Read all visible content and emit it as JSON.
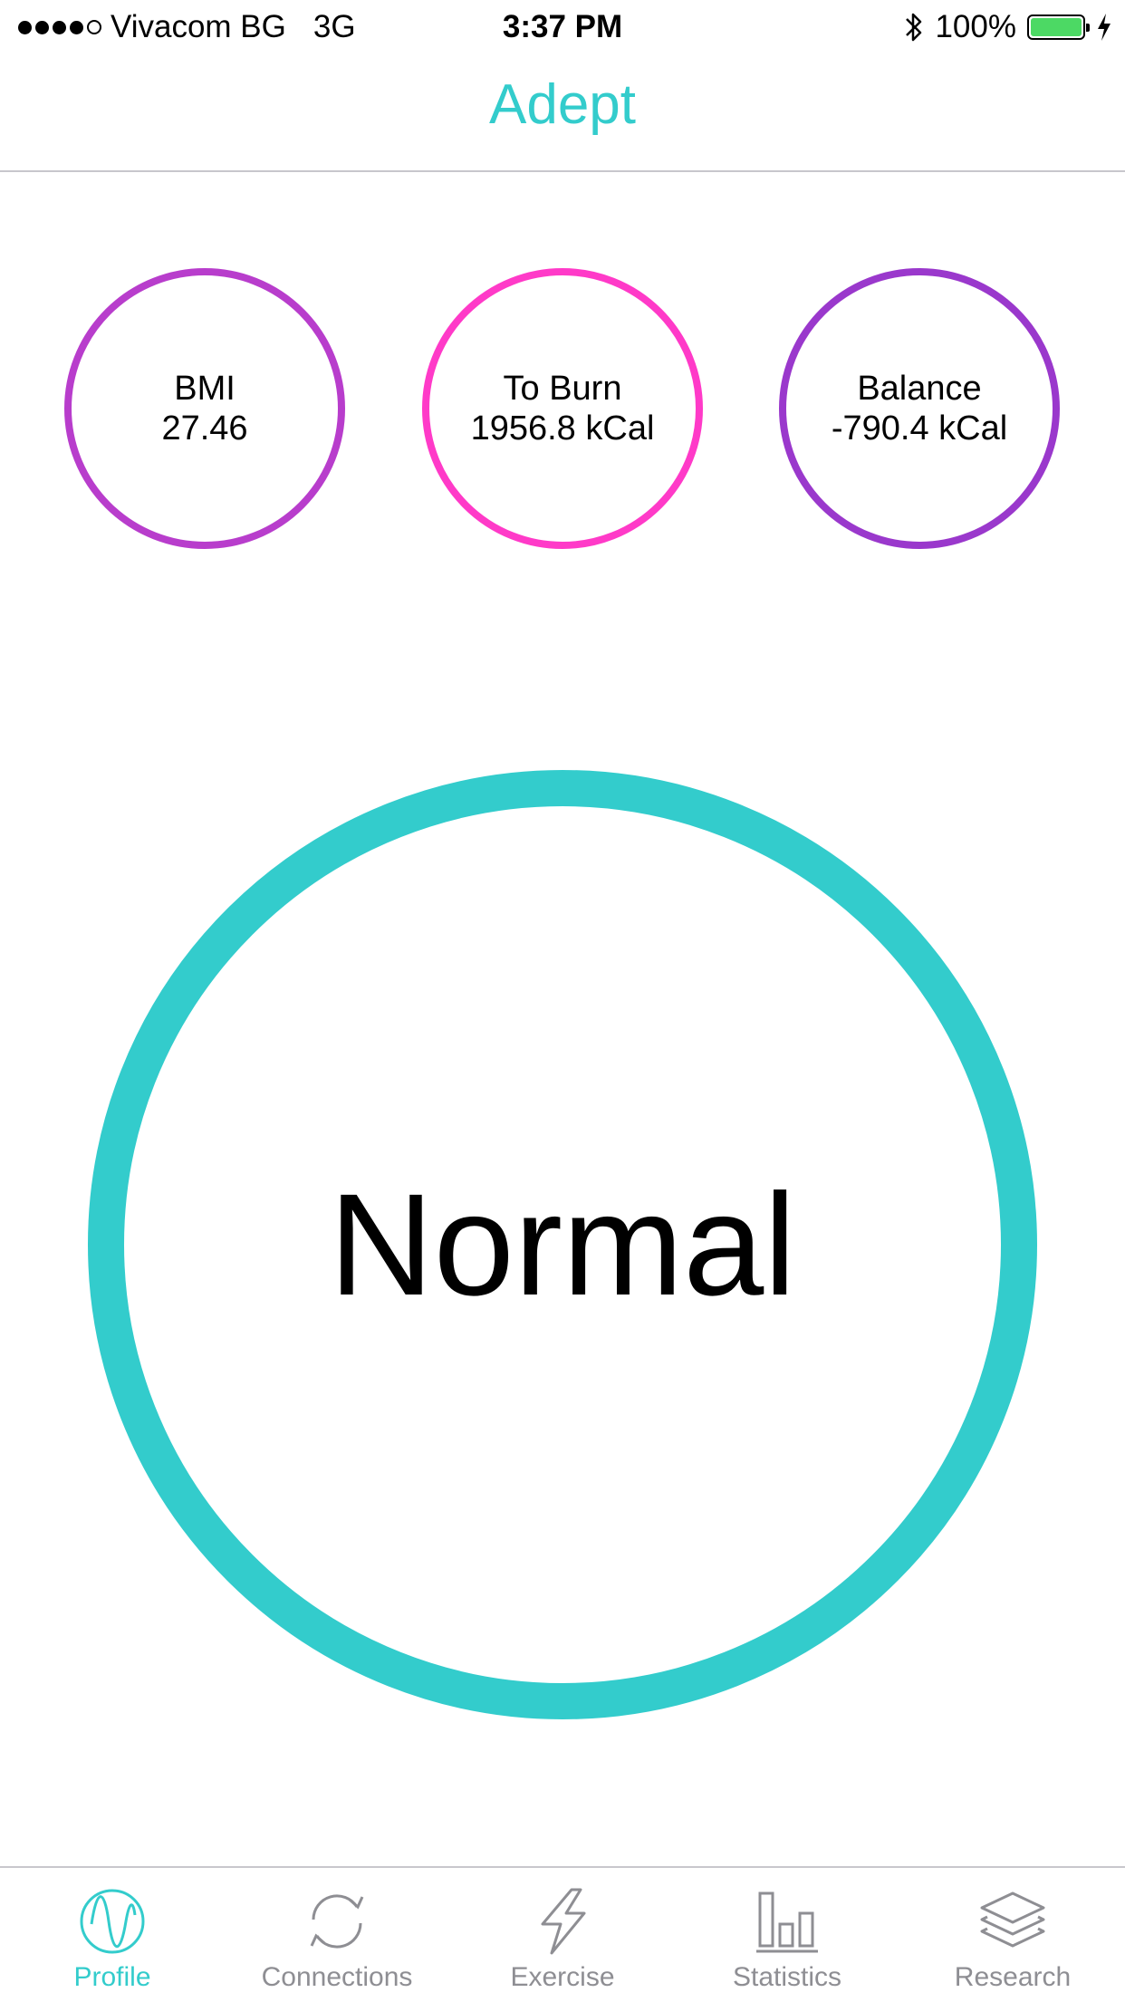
{
  "status_bar": {
    "carrier": "Vivacom BG",
    "network": "3G",
    "time": "3:37 PM",
    "battery": "100%",
    "battery_level": 1.0,
    "bluetooth_icon": "bluetooth-icon",
    "charging_icon": "charging-bolt-icon"
  },
  "nav": {
    "title": "Adept",
    "title_color": "#33cccc"
  },
  "metrics": [
    {
      "label": "BMI",
      "value": "27.46",
      "color": "#b83dcc"
    },
    {
      "label": "To Burn",
      "value": "1956.8 kCal",
      "color": "#ff3ac8"
    },
    {
      "label": "Balance",
      "value": "-790.4 kCal",
      "color": "#9a38cc"
    }
  ],
  "status": {
    "label": "Normal",
    "ring_color": "#33cccc"
  },
  "tabs": [
    {
      "label": "Profile",
      "icon": "wave-icon",
      "active": true
    },
    {
      "label": "Connections",
      "icon": "sync-icon",
      "active": false
    },
    {
      "label": "Exercise",
      "icon": "lightning-icon",
      "active": false
    },
    {
      "label": "Statistics",
      "icon": "bar-chart-icon",
      "active": false
    },
    {
      "label": "Research",
      "icon": "layers-icon",
      "active": false
    }
  ],
  "colors": {
    "accent": "#33cccc",
    "inactive": "#8e8e93",
    "battery": "#4cd964"
  }
}
